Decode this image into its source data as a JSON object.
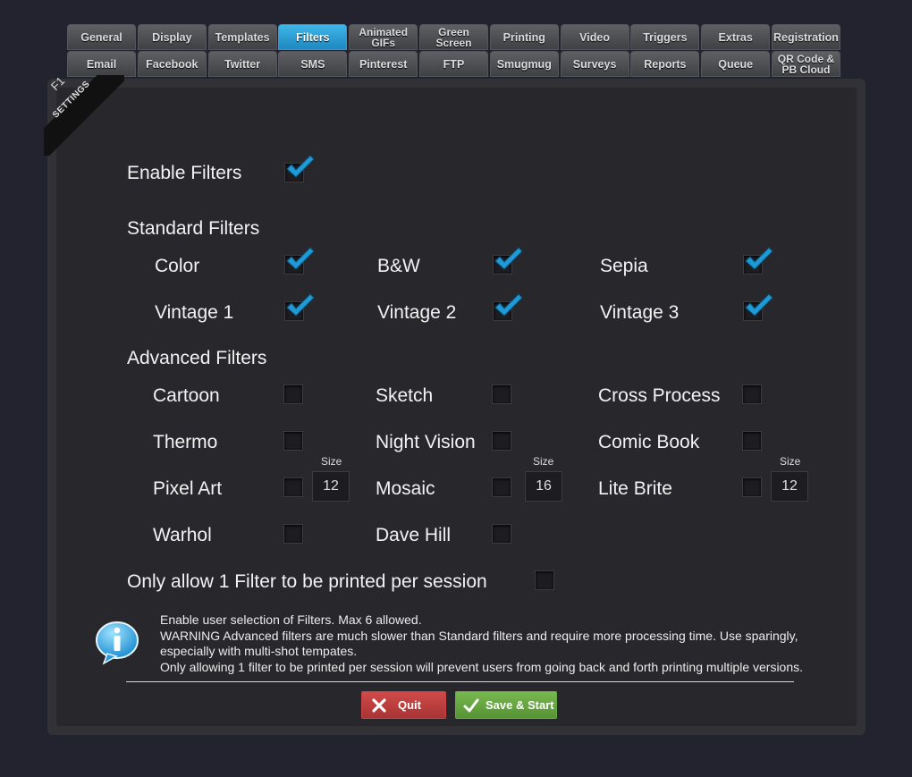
{
  "tabs": {
    "row1": [
      "General",
      "Display",
      "Templates",
      "Filters",
      "Animated GIFs",
      "Green Screen",
      "Printing",
      "Video",
      "Triggers",
      "Extras",
      "Registration"
    ],
    "row2": [
      "Email",
      "Facebook",
      "Twitter",
      "SMS",
      "Pinterest",
      "FTP",
      "Smugmug",
      "Surveys",
      "Reports",
      "Queue",
      "QR Code & PB Cloud"
    ],
    "active": "Filters"
  },
  "ribbon": {
    "key": "F1",
    "label": "SETTINGS"
  },
  "enable_filters": {
    "label": "Enable Filters",
    "checked": true
  },
  "standard": {
    "title": "Standard Filters",
    "items": [
      {
        "label": "Color",
        "checked": true
      },
      {
        "label": "B&W",
        "checked": true
      },
      {
        "label": "Sepia",
        "checked": true
      },
      {
        "label": "Vintage 1",
        "checked": true
      },
      {
        "label": "Vintage 2",
        "checked": true
      },
      {
        "label": "Vintage 3",
        "checked": true
      }
    ]
  },
  "advanced": {
    "title": "Advanced Filters",
    "size_label": "Size",
    "items": [
      {
        "label": "Cartoon",
        "checked": false
      },
      {
        "label": "Sketch",
        "checked": false
      },
      {
        "label": "Cross Process",
        "checked": false
      },
      {
        "label": "Thermo",
        "checked": false
      },
      {
        "label": "Night Vision",
        "checked": false
      },
      {
        "label": "Comic Book",
        "checked": false
      },
      {
        "label": "Pixel Art",
        "checked": false,
        "size": "12"
      },
      {
        "label": "Mosaic",
        "checked": false,
        "size": "16"
      },
      {
        "label": "Lite Brite",
        "checked": false,
        "size": "12"
      },
      {
        "label": "Warhol",
        "checked": false
      },
      {
        "label": "Dave Hill",
        "checked": false
      }
    ]
  },
  "only_one": {
    "label": "Only allow 1 Filter to be printed per session",
    "checked": false
  },
  "info": {
    "line1": "Enable user selection of Filters.  Max 6 allowed.",
    "line2": "WARNING Advanced filters are much slower than Standard filters and require more processing time.  Use sparingly,",
    "line3": "especially with multi-shot tempates.",
    "line4": "Only allowing 1 filter to be printed per session will prevent users from going back and forth printing multiple versions."
  },
  "buttons": {
    "quit": "Quit",
    "save": "Save & Start"
  },
  "colors": {
    "accent": "#1e9bd7",
    "quit": "#b83c3c",
    "save": "#62a43f",
    "background": "#23222f"
  }
}
